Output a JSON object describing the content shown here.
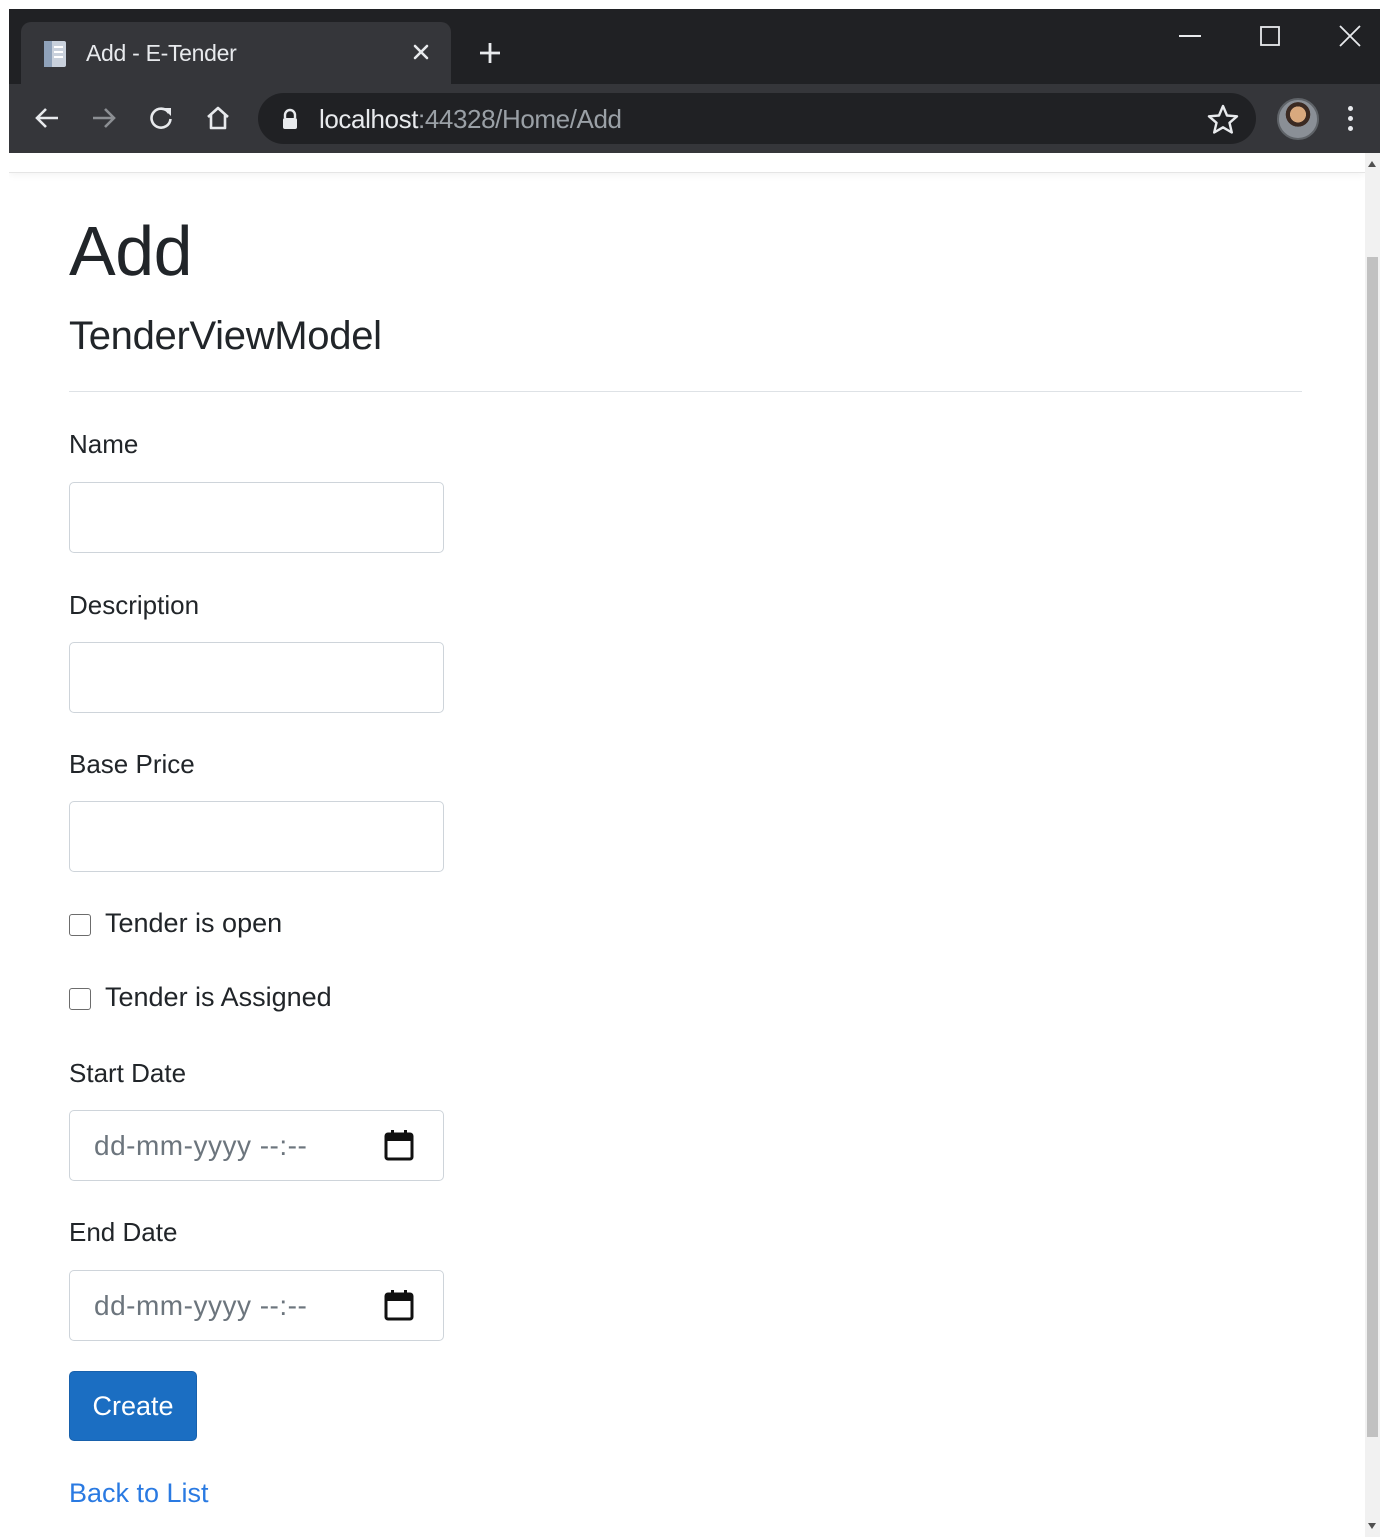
{
  "browser": {
    "tab_title": "Add - E-Tender",
    "url_host": "localhost",
    "url_rest": ":44328/Home/Add"
  },
  "page": {
    "heading": "Add",
    "subheading": "TenderViewModel"
  },
  "form": {
    "name_label": "Name",
    "name_value": "",
    "description_label": "Description",
    "description_value": "",
    "base_price_label": "Base Price",
    "base_price_value": "",
    "tender_open_label": "Tender is open",
    "tender_open_checked": false,
    "tender_assigned_label": "Tender is Assigned",
    "tender_assigned_checked": false,
    "start_date_label": "Start Date",
    "start_date_placeholder": "dd-mm-yyyy --:--",
    "end_date_label": "End Date",
    "end_date_placeholder": "dd-mm-yyyy --:--",
    "submit_label": "Create"
  },
  "links": {
    "back_to_list": "Back to List"
  },
  "colors": {
    "primary_button": "#1b6ec2",
    "link": "#2a7ae2",
    "chrome_dark": "#202124"
  }
}
